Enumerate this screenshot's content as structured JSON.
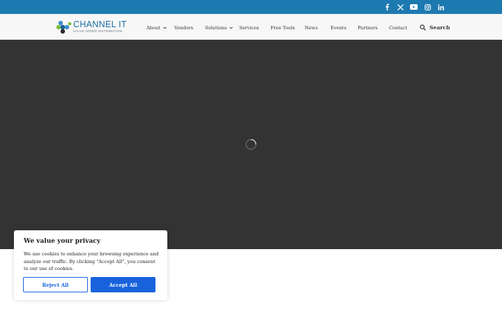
{
  "topbar": {
    "background": "#1d7ab1",
    "social": [
      "facebook-icon",
      "x-icon",
      "youtube-icon",
      "instagram-icon",
      "linkedin-icon"
    ]
  },
  "logo": {
    "name": "CHANNEL IT",
    "tagline": "VALUE ADDED DISTRIBUTION"
  },
  "nav": {
    "items": [
      {
        "label": "About",
        "dropdown": true
      },
      {
        "label": "Vendors",
        "dropdown": false
      },
      {
        "label": "Solutions",
        "dropdown": true
      },
      {
        "label": "Services",
        "dropdown": false
      },
      {
        "label": "Free Tools",
        "dropdown": false
      },
      {
        "label": "News",
        "dropdown": false
      },
      {
        "label": "Events",
        "dropdown": false
      },
      {
        "label": "Partners",
        "dropdown": false
      },
      {
        "label": "Contact",
        "dropdown": false
      }
    ],
    "search_label": "Search"
  },
  "hero": {
    "background": "#333333",
    "state": "loading"
  },
  "cookie": {
    "title": "We value your privacy",
    "text": "We use cookies to enhance your browsing experience and analyze our traffic. By clicking \"Accept All\", you consent to our use of cookies.",
    "reject_label": "Reject All",
    "accept_label": "Accept All",
    "accent": "#1863dc"
  }
}
